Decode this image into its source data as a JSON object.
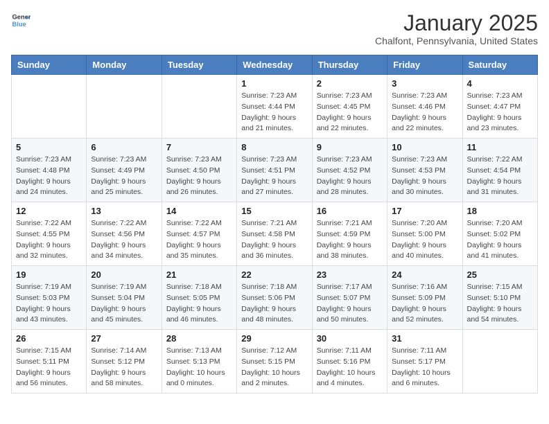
{
  "header": {
    "logo": {
      "line1": "General",
      "line2": "Blue"
    },
    "title": "January 2025",
    "subtitle": "Chalfont, Pennsylvania, United States"
  },
  "days_of_week": [
    "Sunday",
    "Monday",
    "Tuesday",
    "Wednesday",
    "Thursday",
    "Friday",
    "Saturday"
  ],
  "weeks": [
    [
      {
        "day": "",
        "sunrise": "",
        "sunset": "",
        "daylight": ""
      },
      {
        "day": "",
        "sunrise": "",
        "sunset": "",
        "daylight": ""
      },
      {
        "day": "",
        "sunrise": "",
        "sunset": "",
        "daylight": ""
      },
      {
        "day": "1",
        "sunrise": "7:23 AM",
        "sunset": "4:44 PM",
        "daylight": "9 hours and 21 minutes."
      },
      {
        "day": "2",
        "sunrise": "7:23 AM",
        "sunset": "4:45 PM",
        "daylight": "9 hours and 22 minutes."
      },
      {
        "day": "3",
        "sunrise": "7:23 AM",
        "sunset": "4:46 PM",
        "daylight": "9 hours and 22 minutes."
      },
      {
        "day": "4",
        "sunrise": "7:23 AM",
        "sunset": "4:47 PM",
        "daylight": "9 hours and 23 minutes."
      }
    ],
    [
      {
        "day": "5",
        "sunrise": "7:23 AM",
        "sunset": "4:48 PM",
        "daylight": "9 hours and 24 minutes."
      },
      {
        "day": "6",
        "sunrise": "7:23 AM",
        "sunset": "4:49 PM",
        "daylight": "9 hours and 25 minutes."
      },
      {
        "day": "7",
        "sunrise": "7:23 AM",
        "sunset": "4:50 PM",
        "daylight": "9 hours and 26 minutes."
      },
      {
        "day": "8",
        "sunrise": "7:23 AM",
        "sunset": "4:51 PM",
        "daylight": "9 hours and 27 minutes."
      },
      {
        "day": "9",
        "sunrise": "7:23 AM",
        "sunset": "4:52 PM",
        "daylight": "9 hours and 28 minutes."
      },
      {
        "day": "10",
        "sunrise": "7:23 AM",
        "sunset": "4:53 PM",
        "daylight": "9 hours and 30 minutes."
      },
      {
        "day": "11",
        "sunrise": "7:22 AM",
        "sunset": "4:54 PM",
        "daylight": "9 hours and 31 minutes."
      }
    ],
    [
      {
        "day": "12",
        "sunrise": "7:22 AM",
        "sunset": "4:55 PM",
        "daylight": "9 hours and 32 minutes."
      },
      {
        "day": "13",
        "sunrise": "7:22 AM",
        "sunset": "4:56 PM",
        "daylight": "9 hours and 34 minutes."
      },
      {
        "day": "14",
        "sunrise": "7:22 AM",
        "sunset": "4:57 PM",
        "daylight": "9 hours and 35 minutes."
      },
      {
        "day": "15",
        "sunrise": "7:21 AM",
        "sunset": "4:58 PM",
        "daylight": "9 hours and 36 minutes."
      },
      {
        "day": "16",
        "sunrise": "7:21 AM",
        "sunset": "4:59 PM",
        "daylight": "9 hours and 38 minutes."
      },
      {
        "day": "17",
        "sunrise": "7:20 AM",
        "sunset": "5:00 PM",
        "daylight": "9 hours and 40 minutes."
      },
      {
        "day": "18",
        "sunrise": "7:20 AM",
        "sunset": "5:02 PM",
        "daylight": "9 hours and 41 minutes."
      }
    ],
    [
      {
        "day": "19",
        "sunrise": "7:19 AM",
        "sunset": "5:03 PM",
        "daylight": "9 hours and 43 minutes."
      },
      {
        "day": "20",
        "sunrise": "7:19 AM",
        "sunset": "5:04 PM",
        "daylight": "9 hours and 45 minutes."
      },
      {
        "day": "21",
        "sunrise": "7:18 AM",
        "sunset": "5:05 PM",
        "daylight": "9 hours and 46 minutes."
      },
      {
        "day": "22",
        "sunrise": "7:18 AM",
        "sunset": "5:06 PM",
        "daylight": "9 hours and 48 minutes."
      },
      {
        "day": "23",
        "sunrise": "7:17 AM",
        "sunset": "5:07 PM",
        "daylight": "9 hours and 50 minutes."
      },
      {
        "day": "24",
        "sunrise": "7:16 AM",
        "sunset": "5:09 PM",
        "daylight": "9 hours and 52 minutes."
      },
      {
        "day": "25",
        "sunrise": "7:15 AM",
        "sunset": "5:10 PM",
        "daylight": "9 hours and 54 minutes."
      }
    ],
    [
      {
        "day": "26",
        "sunrise": "7:15 AM",
        "sunset": "5:11 PM",
        "daylight": "9 hours and 56 minutes."
      },
      {
        "day": "27",
        "sunrise": "7:14 AM",
        "sunset": "5:12 PM",
        "daylight": "9 hours and 58 minutes."
      },
      {
        "day": "28",
        "sunrise": "7:13 AM",
        "sunset": "5:13 PM",
        "daylight": "10 hours and 0 minutes."
      },
      {
        "day": "29",
        "sunrise": "7:12 AM",
        "sunset": "5:15 PM",
        "daylight": "10 hours and 2 minutes."
      },
      {
        "day": "30",
        "sunrise": "7:11 AM",
        "sunset": "5:16 PM",
        "daylight": "10 hours and 4 minutes."
      },
      {
        "day": "31",
        "sunrise": "7:11 AM",
        "sunset": "5:17 PM",
        "daylight": "10 hours and 6 minutes."
      },
      {
        "day": "",
        "sunrise": "",
        "sunset": "",
        "daylight": ""
      }
    ]
  ]
}
